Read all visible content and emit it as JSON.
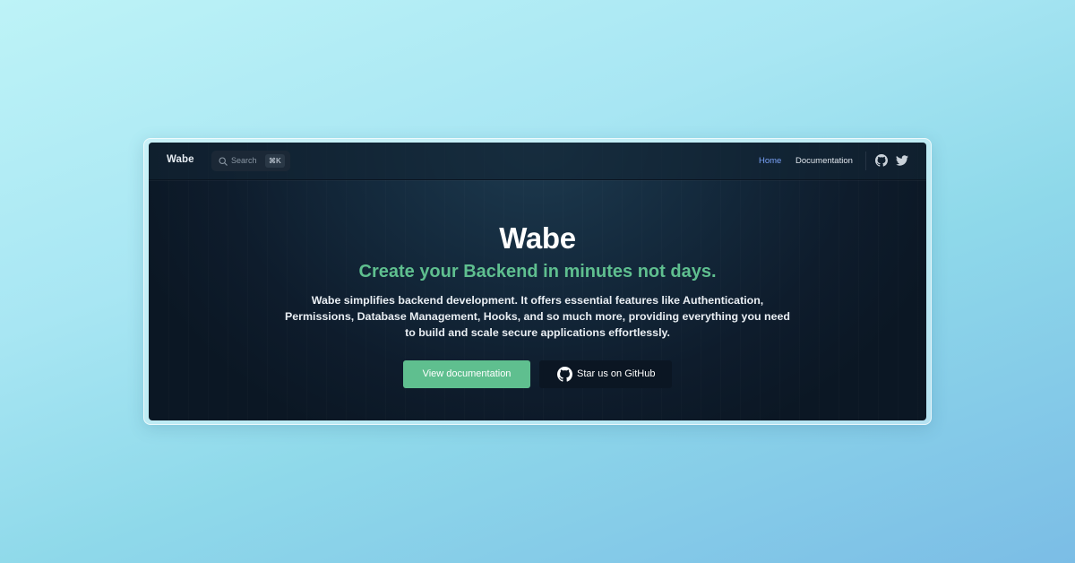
{
  "navbar": {
    "brand": "Wabe",
    "search": {
      "placeholder": "Search",
      "shortcut": "⌘K"
    },
    "links": [
      {
        "label": "Home",
        "active": true
      },
      {
        "label": "Documentation",
        "active": false
      }
    ],
    "icons": [
      "github-icon",
      "twitter-icon"
    ]
  },
  "hero": {
    "title": "Wabe",
    "subtitle": "Create your Backend in minutes not days.",
    "description": "Wabe simplifies backend development. It offers essential features like Authentication, Permissions, Database Management, Hooks, and so much more, providing everything you need to build and scale secure applications effortlessly.",
    "primary_button": "View documentation",
    "secondary_button": "Star us on GitHub"
  },
  "colors": {
    "accent_green": "#5fbf8f",
    "active_link": "#7aa2f7",
    "window_bg": "#0e1c2c"
  }
}
